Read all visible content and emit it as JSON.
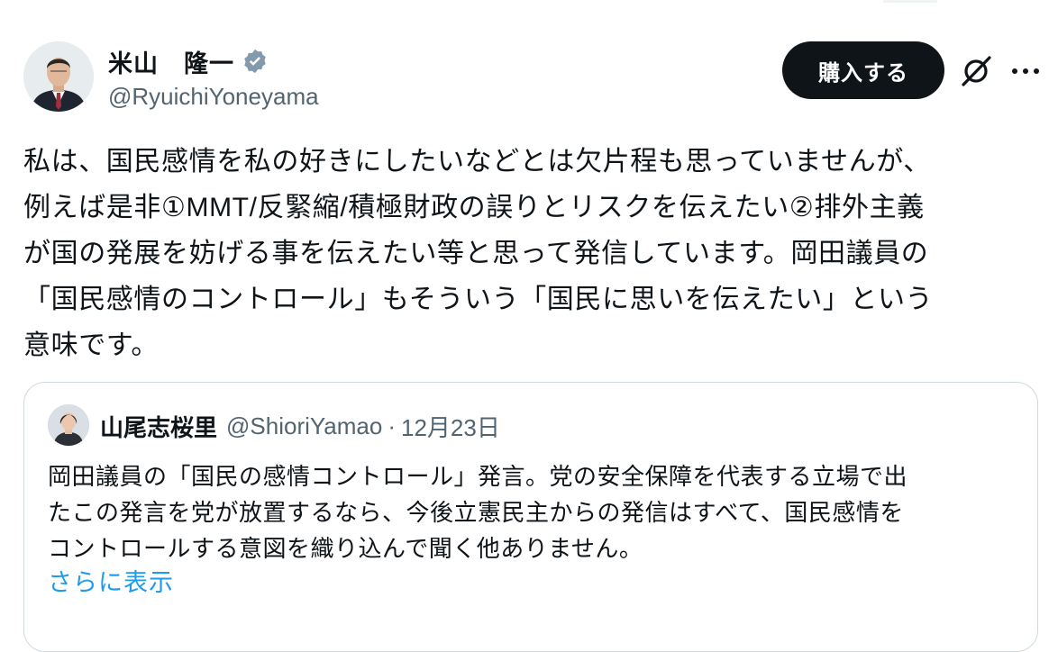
{
  "post": {
    "author": {
      "display_name": "米山　隆一",
      "handle": "@RyuichiYoneyama",
      "verified": true
    },
    "actions": {
      "buy_label": "購入する",
      "grok_icon": "grok-icon",
      "more_icon": "more-icon"
    },
    "text": "私は、国民感情を私の好きにしたいなどとは欠片程も思っていませんが、\n例えば是非①MMT/反緊縮/積極財政の誤りとリスクを伝えたい②排外主義\nが国の発展を妨げる事を伝えたい等と思って発信しています。岡田議員の\n「国民感情のコントロール」もそういう「国民に思いを伝えたい」という\n意味です。"
  },
  "quote": {
    "author": {
      "display_name": "山尾志桜里",
      "handle": "@ShioriYamao",
      "separator": "·",
      "date": "12月23日"
    },
    "text": "岡田議員の「国民の感情コントロール」発言。党の安全保障を代表する立場で出\nたこの発言を党が放置するなら、今後立憲民主からの発信はすべて、国民感情を\nコントロールする意図を織り込んで聞く他ありません。",
    "show_more_label": "さらに表示"
  },
  "colors": {
    "text_primary": "#0f1419",
    "text_secondary": "#536471",
    "link": "#1d9bf0",
    "verified_badge": "#829aab",
    "button_bg": "#0f1419",
    "border": "#cfd9de"
  }
}
